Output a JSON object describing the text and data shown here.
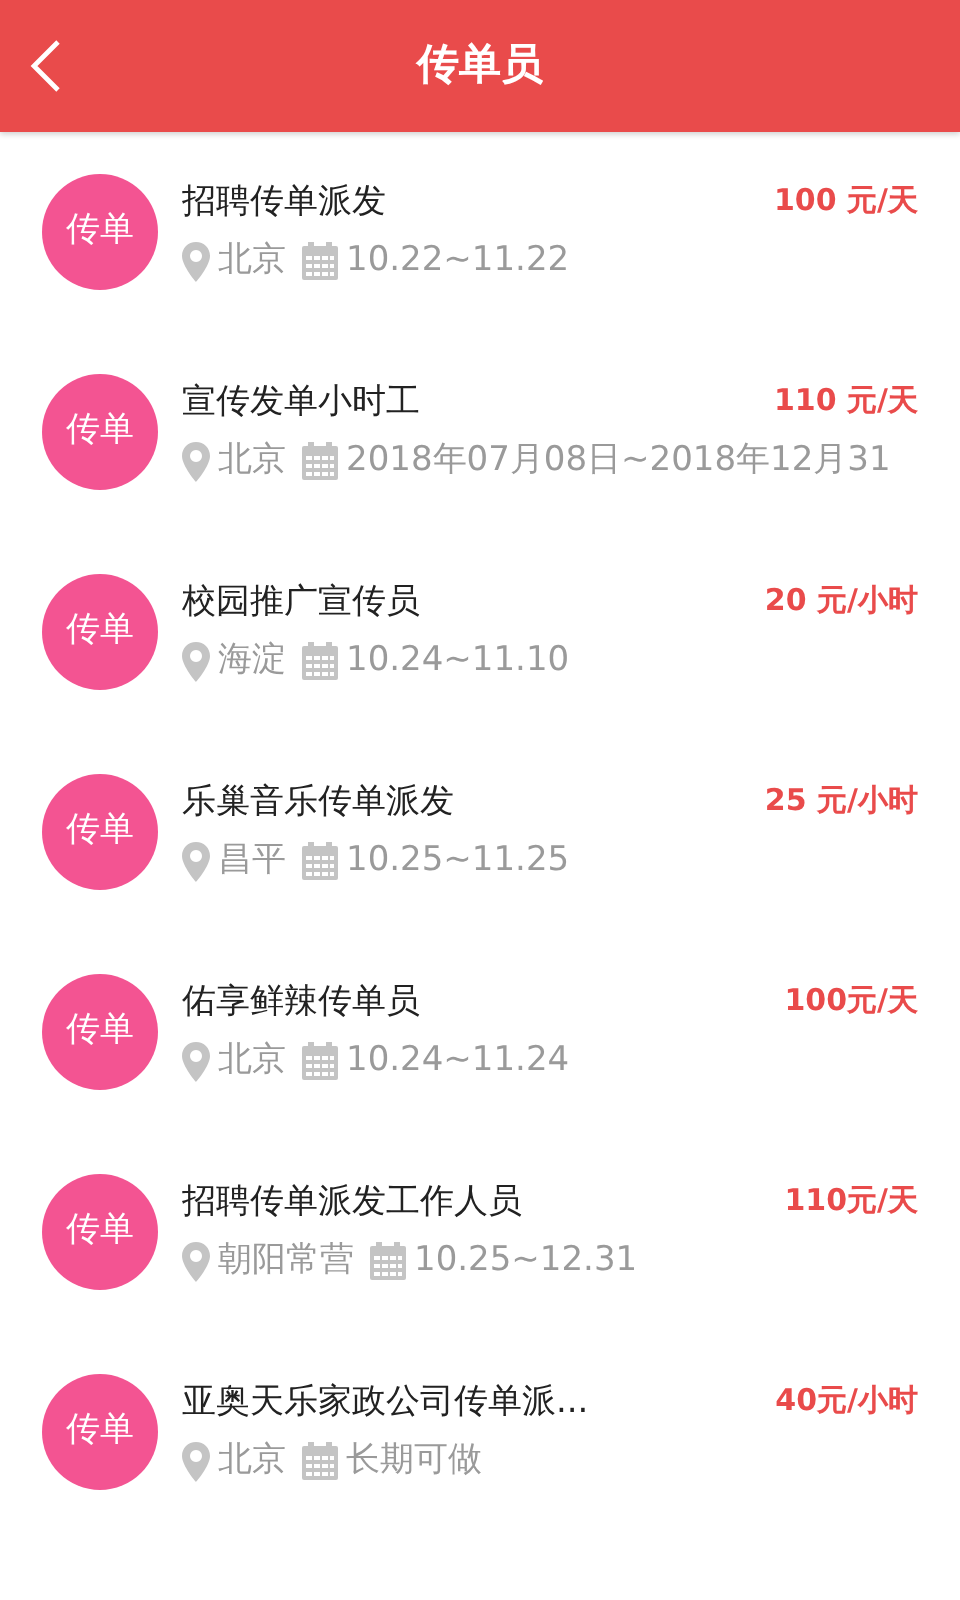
{
  "header": {
    "title": "传单员"
  },
  "jobs": [
    {
      "badge": "传单",
      "title": "招聘传单派发",
      "pay": "100 元/天",
      "location": "北京",
      "date": "10.22~11.22"
    },
    {
      "badge": "传单",
      "title": "宣传发单小时工",
      "pay": "110 元/天",
      "location": "北京",
      "date": "2018年07月08日~2018年12月31"
    },
    {
      "badge": "传单",
      "title": "校园推广宣传员",
      "pay": "20 元/小时",
      "location": "海淀",
      "date": "10.24~11.10"
    },
    {
      "badge": "传单",
      "title": "乐巢音乐传单派发",
      "pay": "25 元/小时",
      "location": "昌平",
      "date": "10.25~11.25"
    },
    {
      "badge": "传单",
      "title": "佑享鲜辣传单员",
      "pay": "100元/天",
      "location": "北京",
      "date": "10.24~11.24"
    },
    {
      "badge": "传单",
      "title": "招聘传单派发工作人员",
      "pay": "110元/天",
      "location": "朝阳常营",
      "date": "10.25~12.31"
    },
    {
      "badge": "传单",
      "title": "亚奥天乐家政公司传单派...",
      "pay": "40元/小时",
      "location": "北京",
      "date": "长期可做"
    }
  ]
}
